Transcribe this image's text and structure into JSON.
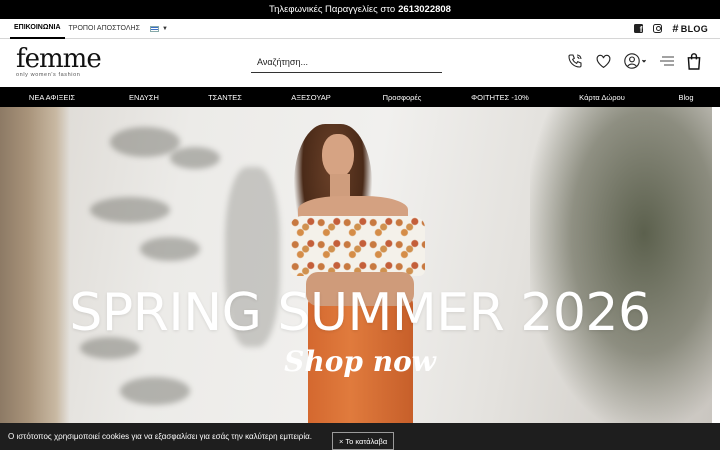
{
  "announcement": {
    "text": "Τηλεφωνικές Παραγγελίες στο",
    "phone": "2613022808"
  },
  "subnav": {
    "contact": "ΕΠΙΚΟΙΝΩΝΙΑ",
    "shipping": "ΤΡΟΠΟΙ ΑΠΟΣΤΟΛΗΣ",
    "language_icon": "greek-flag-icon",
    "blog_label": "BLOG"
  },
  "header": {
    "logo_text": "femme",
    "logo_tagline": "only women's fashion",
    "search_placeholder": "Αναζήτηση..."
  },
  "nav": {
    "items": [
      "ΝΕΑ ΑΦΙΞΕΙΣ",
      "ΕΝΔΥΣΗ",
      "ΤΣΑΝΤΕΣ",
      "ΑΞΕΣΟΥΑΡ",
      "Προσφορές",
      "ΦΟΙΤΗΤΕΣ -10%",
      "Κάρτα Δώρου",
      "Blog"
    ]
  },
  "hero": {
    "title": "SPRING SUMMER 2026",
    "cta": "Shop now"
  },
  "cookie": {
    "message": "Ο ιστότοπος χρησιμοποιεί cookies για να εξασφαλίσει για εσάς την καλύτερη εμπειρία.",
    "button_icon": "×",
    "button_label": "Το κατάλαβα"
  }
}
